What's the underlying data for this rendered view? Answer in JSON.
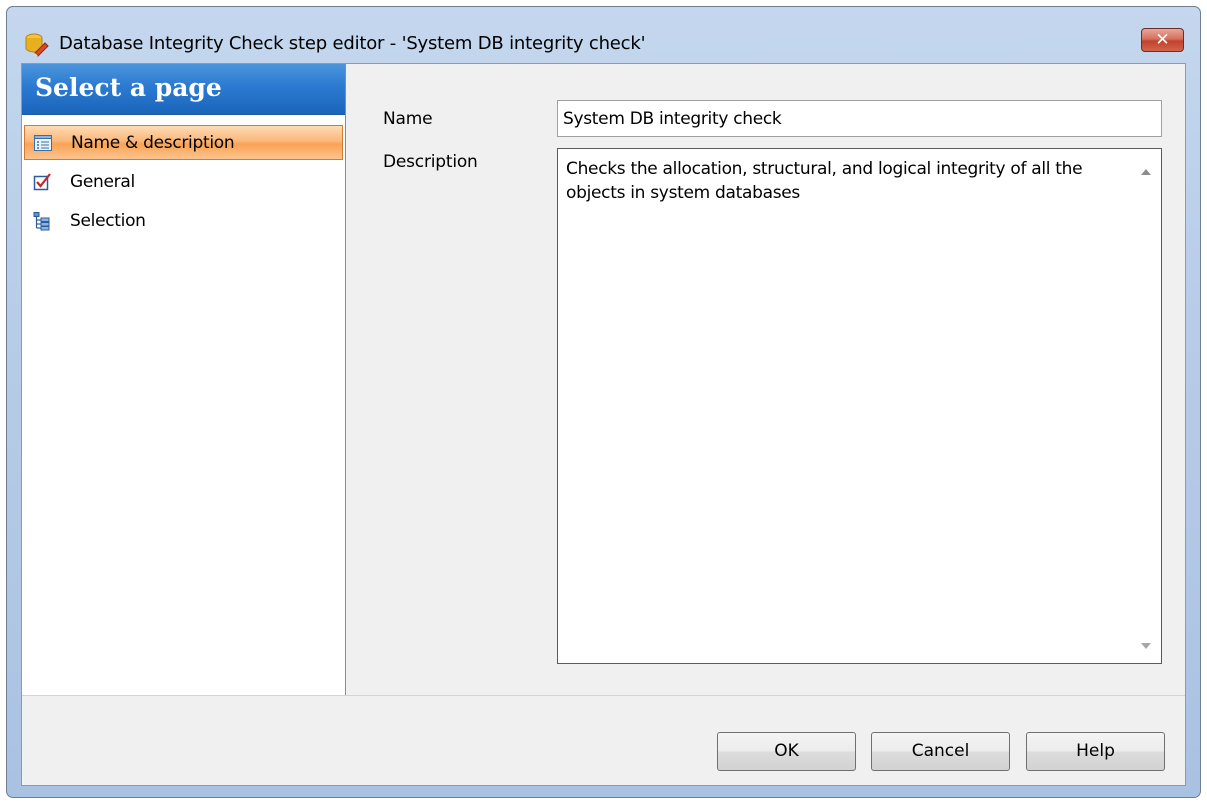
{
  "window": {
    "title": "Database Integrity Check step editor - 'System DB integrity check'",
    "close_label": "✕"
  },
  "sidebar": {
    "header": "Select a page",
    "items": [
      {
        "label": "Name & description",
        "icon": "document-list-icon",
        "selected": true
      },
      {
        "label": "General",
        "icon": "checkbox-icon",
        "selected": false
      },
      {
        "label": "Selection",
        "icon": "tree-icon",
        "selected": false
      }
    ]
  },
  "form": {
    "name_label": "Name",
    "name_value": "System DB integrity check",
    "description_label": "Description",
    "description_value": "Checks the allocation, structural, and logical integrity of all the objects in system databases"
  },
  "buttons": {
    "ok": "OK",
    "cancel": "Cancel",
    "help": "Help"
  },
  "colors": {
    "header_blue": "#2b7ad1",
    "selected_orange": "#f9a356",
    "close_red": "#c2432b"
  }
}
